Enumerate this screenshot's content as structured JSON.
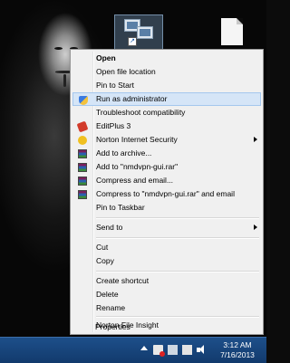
{
  "menu": {
    "items": [
      {
        "label": "Open",
        "bold": true
      },
      {
        "label": "Open file location"
      },
      {
        "label": "Pin to Start"
      },
      {
        "label": "Run as administrator",
        "icon": "uac-shield-icon",
        "highlighted": true
      },
      {
        "label": "Troubleshoot compatibility"
      },
      {
        "label": "EditPlus 3",
        "icon": "editplus-icon"
      },
      {
        "label": "Norton Internet Security",
        "icon": "norton-icon",
        "submenu": true
      },
      {
        "label": "Add to archive...",
        "icon": "winrar-icon"
      },
      {
        "label": "Add to \"nmdvpn-gui.rar\"",
        "icon": "winrar-icon"
      },
      {
        "label": "Compress and email...",
        "icon": "winrar-icon"
      },
      {
        "label": "Compress to \"nmdvpn-gui.rar\" and email",
        "icon": "winrar-icon"
      },
      {
        "label": "Pin to Taskbar"
      },
      {
        "label": "Send to",
        "submenu": true
      },
      {
        "label": "Cut"
      },
      {
        "label": "Copy"
      },
      {
        "label": "Create shortcut"
      },
      {
        "label": "Delete"
      },
      {
        "label": "Rename"
      },
      {
        "label": "Norton File Insight"
      },
      {
        "label": "Properties"
      }
    ]
  },
  "taskbar": {
    "clock_time": "3:12 AM",
    "clock_date": "7/16/2013"
  },
  "colors": {
    "menu_bg": "#f0f0f0",
    "highlight": "#d5e5f7",
    "taskbar": "#1d4f8a"
  }
}
